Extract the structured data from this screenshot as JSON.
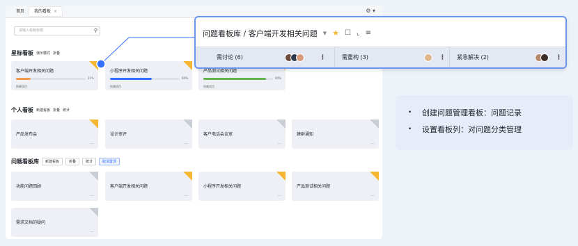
{
  "tabs": [
    {
      "label": "首页"
    },
    {
      "label": "我的看板",
      "close": "×"
    }
  ],
  "search": {
    "placeholder": "请输入看板标题"
  },
  "star_section": {
    "title": "星标看板",
    "sub1": "演示模式",
    "sub2": "折叠"
  },
  "star_cards": [
    {
      "title": "客户端开发相关问题",
      "progress": 0.21,
      "pct": "21%",
      "project": "所属项目",
      "color": "#f59a4a"
    },
    {
      "title": "小程序开发相关问题",
      "progress": 0.6,
      "pct": "60%",
      "project": "所属项目",
      "color": "#3370ff"
    },
    {
      "title": "产品测试相关问题",
      "progress": 0.9,
      "pct": "90%",
      "project": "所属项目",
      "color": "#62b549"
    }
  ],
  "personal_section": {
    "title": "个人看板",
    "sub1": "新建看板",
    "sub2": "折叠",
    "sub3": "统计"
  },
  "personal_cards": [
    {
      "title": "产品发布会"
    },
    {
      "title": "设计审评"
    },
    {
      "title": "客户电话会议室"
    },
    {
      "title": "建群通知"
    }
  ],
  "library_section": {
    "title": "问题看板库",
    "b1": "新建看板",
    "b2": "折叠",
    "b3": "统计",
    "b4": "取消置顶"
  },
  "library_cards": [
    {
      "title": "功能问题回顾"
    },
    {
      "title": "客户端开发相关问题"
    },
    {
      "title": "小程序开发相关问题"
    },
    {
      "title": "产品测试相关问题"
    },
    {
      "title": "需求文档的疑问"
    }
  ],
  "popup": {
    "breadcrumb": "问题看板库 / 客户端开发相关问题",
    "columns": [
      {
        "label": "需讨论 (6)"
      },
      {
        "label": "需重构 (3)"
      },
      {
        "label": "紧急解决 (2)"
      }
    ]
  },
  "note": {
    "items": [
      "创建问题管理看板：问题记录",
      "设置看板列：对问题分类管理"
    ]
  },
  "colors": {
    "accent": "#3370ff",
    "star": "#f5b731",
    "popup_border": "#6a95ef"
  }
}
